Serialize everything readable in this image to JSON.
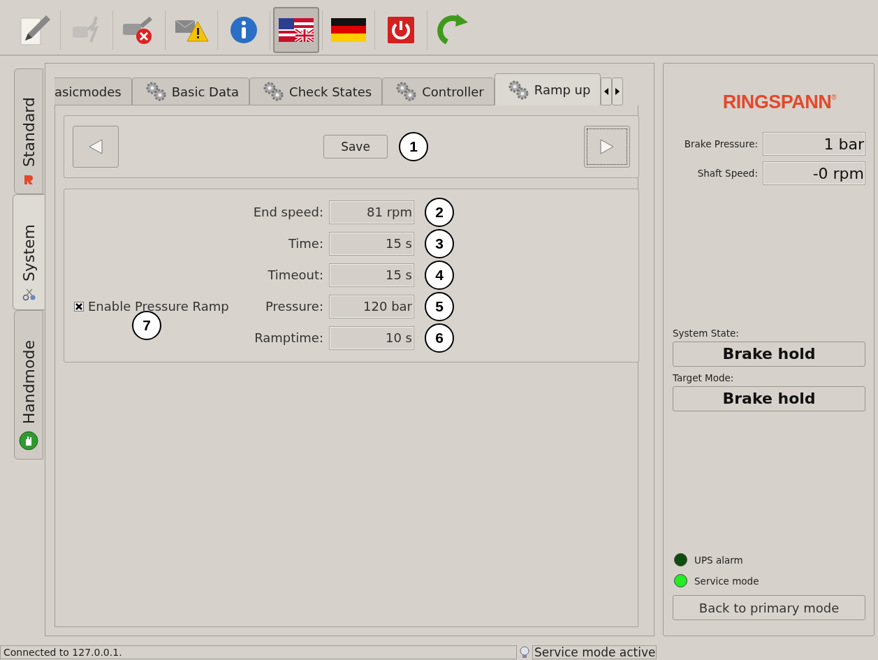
{
  "toolbar": [
    {
      "kind": "pencil",
      "selected": false,
      "disabled": false
    },
    {
      "kind": "plug-flash",
      "selected": false,
      "disabled": true
    },
    {
      "kind": "plug-error",
      "selected": false,
      "disabled": false
    },
    {
      "kind": "mail-warning",
      "selected": false,
      "disabled": false
    },
    {
      "kind": "info",
      "selected": false,
      "disabled": false
    },
    {
      "kind": "flag-en",
      "selected": true,
      "disabled": false
    },
    {
      "kind": "flag-de",
      "selected": false,
      "disabled": false
    },
    {
      "kind": "power",
      "selected": false,
      "disabled": false
    },
    {
      "kind": "refresh",
      "selected": false,
      "disabled": false
    }
  ],
  "side_tabs": [
    {
      "label": "Standard",
      "kind": "logo",
      "selected": false
    },
    {
      "label": "System",
      "kind": "tools",
      "selected": true
    },
    {
      "label": "Handmode",
      "kind": "hand",
      "selected": false
    }
  ],
  "tabs": [
    {
      "label": "asicmodes",
      "gear": false,
      "selected": false
    },
    {
      "label": "Basic Data",
      "gear": true,
      "selected": false
    },
    {
      "label": "Check States",
      "gear": true,
      "selected": false
    },
    {
      "label": "Controller",
      "gear": true,
      "selected": false
    },
    {
      "label": "Ramp up",
      "gear": true,
      "selected": true
    }
  ],
  "nav": {
    "save": "Save",
    "callout": "1"
  },
  "form": {
    "checkbox": {
      "label": "Enable Pressure Ramp",
      "checked": true,
      "callout": "7"
    },
    "fields": [
      {
        "label": "End speed:",
        "value": "81 rpm",
        "callout": "2"
      },
      {
        "label": "Time:",
        "value": "15 s",
        "callout": "3"
      },
      {
        "label": "Timeout:",
        "value": "15 s",
        "callout": "4"
      },
      {
        "label": "Pressure:",
        "value": "120 bar",
        "callout": "5"
      },
      {
        "label": "Ramptime:",
        "value": "10 s",
        "callout": "6"
      }
    ]
  },
  "right_panel": {
    "logo": "RINGSPANN$^{®}$",
    "readings": [
      {
        "label": "Brake Pressure:",
        "value": "1 bar"
      },
      {
        "label": "Shaft Speed:",
        "value": "-0 rpm"
      }
    ],
    "states": [
      {
        "label": "System State:",
        "value": "Brake hold"
      },
      {
        "label": "Target Mode:",
        "value": "Brake hold"
      }
    ],
    "indicators": [
      {
        "label": "UPS alarm",
        "color": "#0d4d0d"
      },
      {
        "label": "Service mode",
        "color": "#22ee22"
      }
    ],
    "button": "Back to primary mode"
  },
  "status_bar": {
    "left": "Connected to 127.0.0.1.",
    "right": "Service mode active"
  }
}
